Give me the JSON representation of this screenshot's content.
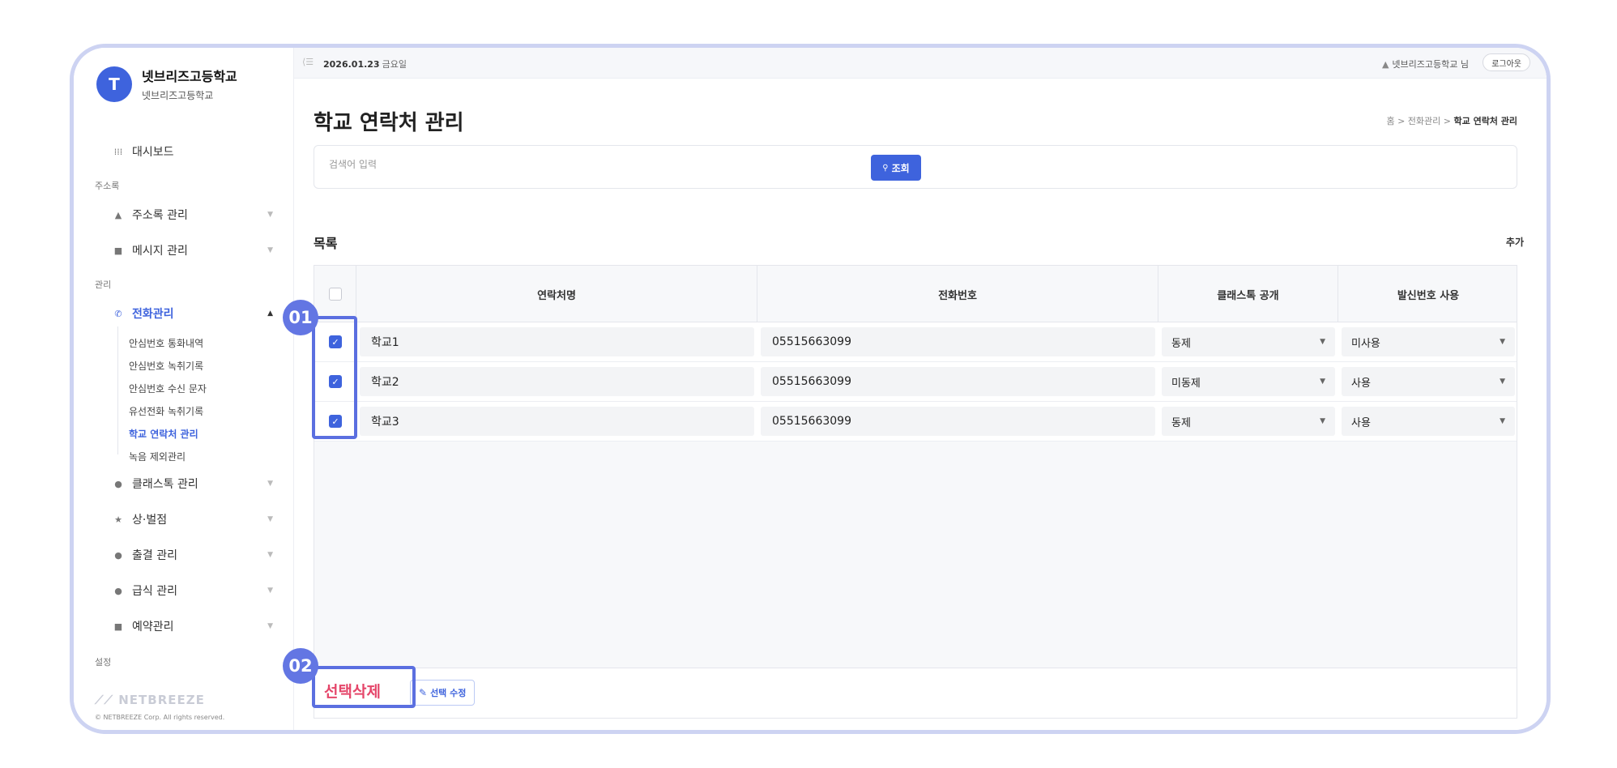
{
  "sidebar": {
    "avatar_letter": "T",
    "school_name": "넷브리즈고등학교",
    "school_sub": "넷브리즈고등학교",
    "dashboard": "대시보드",
    "section_address": "주소록",
    "address_manage": "주소록 관리",
    "message_manage": "메시지 관리",
    "section_manage": "관리",
    "phone_manage": "전화관리",
    "sub_items": [
      "안심번호 통화내역",
      "안심번호 녹취기록",
      "안심번호 수신 문자",
      "유선전화 녹취기록",
      "학교 연락처 관리",
      "녹음 제외관리"
    ],
    "classtalk_manage": "클래스톡 관리",
    "merit": "상·벌점",
    "attendance": "출결 관리",
    "meal": "급식 관리",
    "reservation": "예약관리",
    "section_settings": "설정",
    "footer_logo": "NETBREEZE",
    "footer_copy": "© NETBREEZE Corp. All rights reserved."
  },
  "topbar": {
    "date": "2026.01.23",
    "weekday": "금요일",
    "user": "넷브리즈고등학교 님",
    "logout": "로그아웃"
  },
  "page": {
    "title": "학교 연락처 관리",
    "breadcrumb_home": "홈",
    "breadcrumb_mid": "전화관리",
    "breadcrumb_current": "학교 연락처 관리"
  },
  "search": {
    "placeholder": "검색어 입력",
    "button": "조회"
  },
  "list": {
    "title": "목록",
    "add": "추가",
    "columns": [
      "연락처명",
      "전화번호",
      "클래스톡 공개",
      "발신번호 사용"
    ],
    "rows": [
      {
        "name": "학교1",
        "phone": "05515663099",
        "public": "동제",
        "sender": "미사용",
        "checked": true
      },
      {
        "name": "학교2",
        "phone": "05515663099",
        "public": "미동제",
        "sender": "사용",
        "checked": true
      },
      {
        "name": "학교3",
        "phone": "05515663099",
        "public": "동제",
        "sender": "사용",
        "checked": true
      }
    ],
    "delete_selected": "선택삭제",
    "edit_selected": "선택 수정"
  },
  "callouts": {
    "one": "01",
    "two": "02"
  },
  "colors": {
    "accent": "#3e63dd",
    "callout": "#5b6fe0",
    "delete": "#e5466a",
    "frame": "#cdd3f2"
  }
}
